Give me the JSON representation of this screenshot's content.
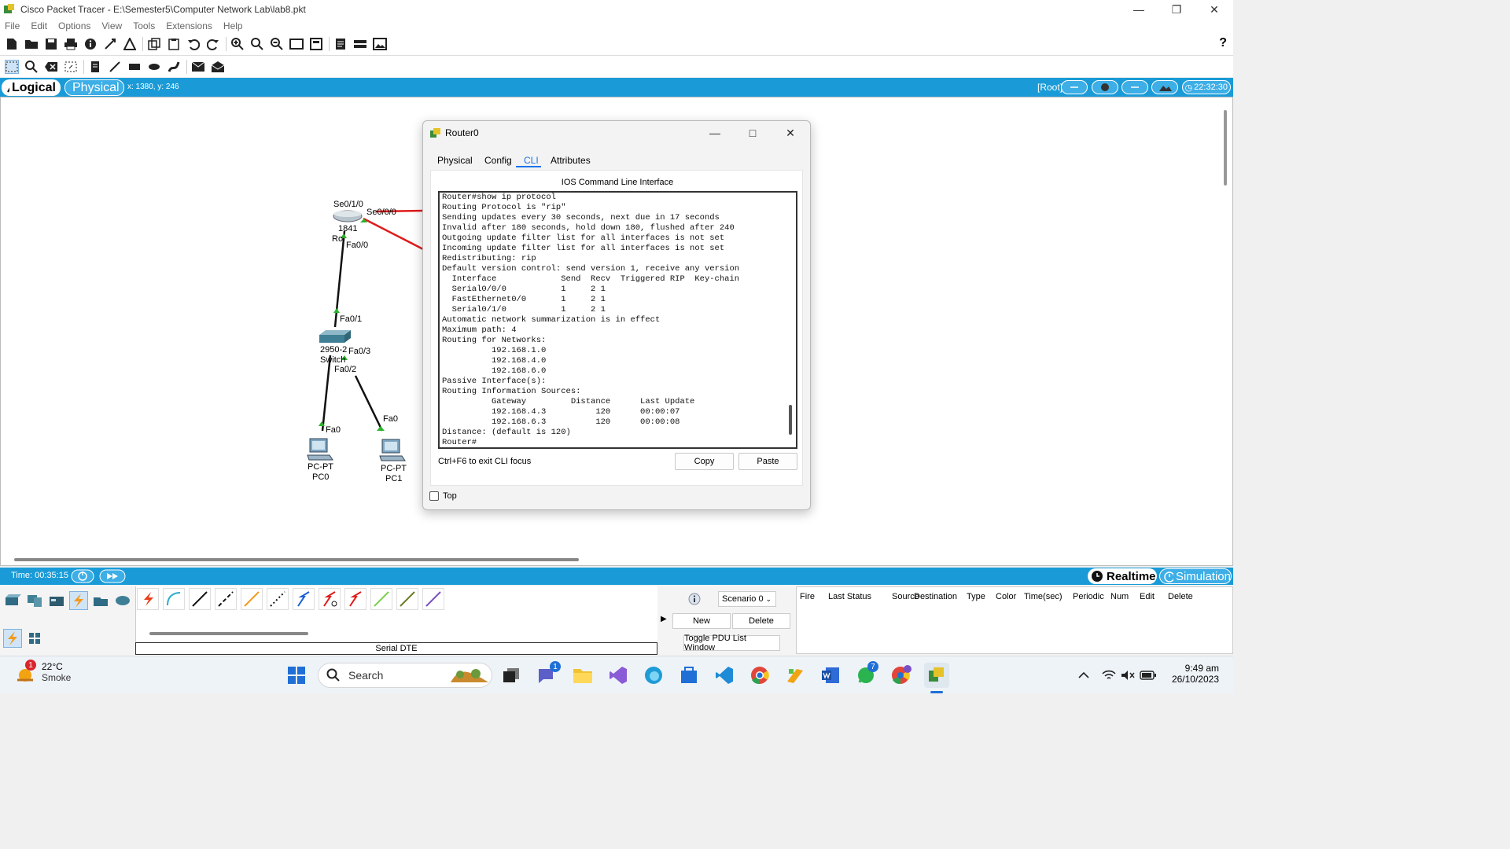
{
  "window": {
    "title": "Cisco Packet Tracer - E:\\Semester5\\Computer Network Lab\\lab8.pkt"
  },
  "menu": [
    "File",
    "Edit",
    "Options",
    "View",
    "Tools",
    "Extensions",
    "Help"
  ],
  "viewbar": {
    "logical_label": "Logical",
    "physical_label": "Physical",
    "coords": "x: 1380, y: 246",
    "root_label": "[Root]",
    "clock": "22:32:30"
  },
  "topology": {
    "router": {
      "model": "1841",
      "name": "Ro",
      "port_se010": "Se0/1/0",
      "port_se000": "Se0/0/0",
      "port_fa00": "Fa0/0"
    },
    "switch": {
      "model": "2950-2",
      "name": "Switch",
      "port_fa01": "Fa0/1",
      "port_fa03": "Fa0/3",
      "port_fa02": "Fa0/2"
    },
    "pc0": {
      "type": "PC-PT",
      "name": "PC0",
      "port": "Fa0"
    },
    "pc1": {
      "type": "PC-PT",
      "name": "PC1",
      "port": "Fa0"
    }
  },
  "dialog": {
    "title": "Router0",
    "tabs": [
      "Physical",
      "Config",
      "CLI",
      "Attributes"
    ],
    "active_tab": "CLI",
    "header": "IOS Command Line Interface",
    "cli_lines": [
      "Router#show ip protocol",
      "Routing Protocol is \"rip\"",
      "Sending updates every 30 seconds, next due in 17 seconds",
      "Invalid after 180 seconds, hold down 180, flushed after 240",
      "Outgoing update filter list for all interfaces is not set",
      "Incoming update filter list for all interfaces is not set",
      "Redistributing: rip",
      "Default version control: send version 1, receive any version",
      "  Interface             Send  Recv  Triggered RIP  Key-chain",
      "  Serial0/0/0           1     2 1",
      "  FastEthernet0/0       1     2 1",
      "  Serial0/1/0           1     2 1",
      "Automatic network summarization is in effect",
      "Maximum path: 4",
      "Routing for Networks:",
      "          192.168.1.0",
      "          192.168.4.0",
      "          192.168.6.0",
      "Passive Interface(s):",
      "Routing Information Sources:",
      "          Gateway         Distance      Last Update",
      "          192.168.4.3          120      00:00:07",
      "          192.168.6.3          120      00:00:08",
      "Distance: (default is 120)",
      "Router#"
    ],
    "hint": "Ctrl+F6 to exit CLI focus",
    "copy_label": "Copy",
    "paste_label": "Paste",
    "top_label": "Top"
  },
  "timebar": {
    "time": "Time: 00:35:15",
    "realtime_label": "Realtime",
    "simulation_label": "Simulation"
  },
  "bottom": {
    "connection_type": "Serial DTE",
    "scenario": "Scenario 0",
    "new_label": "New",
    "delete_label": "Delete",
    "toggle_label": "Toggle PDU List Window",
    "pdu_columns": [
      "Fire",
      "Last Status",
      "Source",
      "Destination",
      "Type",
      "Color",
      "Time(sec)",
      "Periodic",
      "Num",
      "Edit",
      "Delete"
    ]
  },
  "taskbar": {
    "weather_badge": "1",
    "temperature": "22°C",
    "condition": "Smoke",
    "search_placeholder": "Search",
    "teams_badge": "1",
    "whatsapp_badge": "7",
    "time": "9:49 am",
    "date": "26/10/2023"
  },
  "colors": {
    "accent_blue": "#1a9bd7",
    "link_red": "#e01b1b",
    "cli_blue": "#1a73e8"
  }
}
